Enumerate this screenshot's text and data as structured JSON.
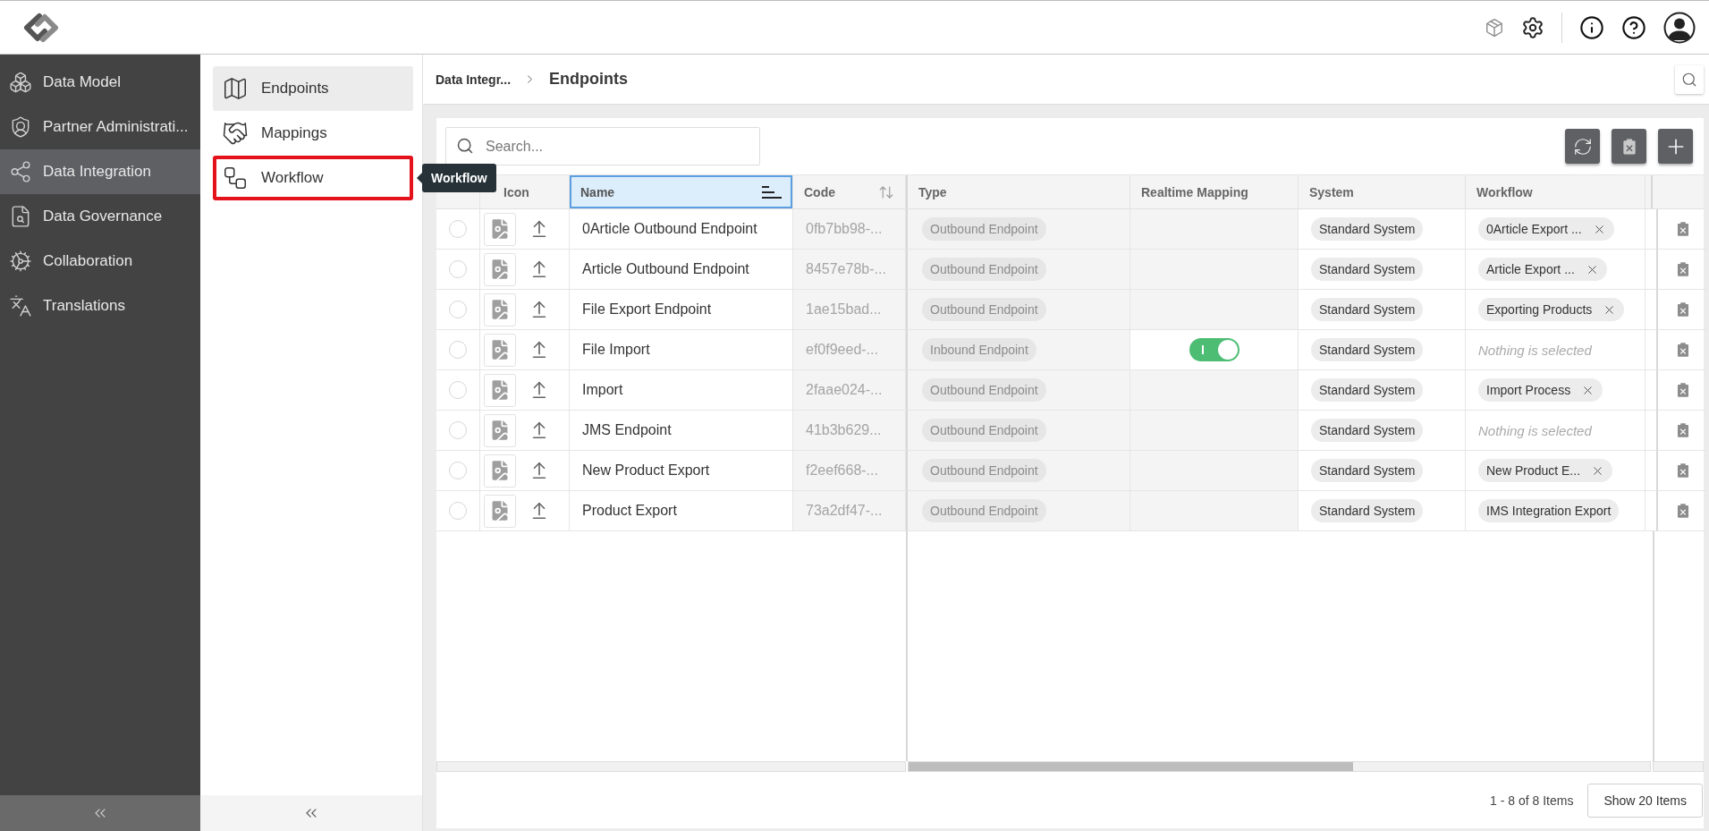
{
  "sidebar": {
    "items": [
      {
        "label": "Data Model",
        "selected": false
      },
      {
        "label": "Partner Administrati...",
        "selected": false
      },
      {
        "label": "Data Integration",
        "selected": true
      },
      {
        "label": "Data Governance",
        "selected": false
      },
      {
        "label": "Collaboration",
        "selected": false
      },
      {
        "label": "Translations",
        "selected": false
      }
    ]
  },
  "subnav": {
    "items": [
      {
        "label": "Endpoints",
        "selected": true,
        "highlighted": false
      },
      {
        "label": "Mappings",
        "selected": false,
        "highlighted": false
      },
      {
        "label": "Workflow",
        "selected": false,
        "highlighted": true,
        "tooltip": "Workflow"
      }
    ]
  },
  "breadcrumb": [
    {
      "label": "Data Integr...",
      "current": false
    },
    {
      "label": "Endpoints",
      "current": true
    }
  ],
  "table": {
    "search": {
      "placeholder": "Search..."
    },
    "columns": [
      {
        "label": "Icon"
      },
      {
        "label": "Name",
        "sorted": true
      },
      {
        "label": "Code",
        "sorted": false
      },
      {
        "label": "Type"
      },
      {
        "label": "Realtime Mapping"
      },
      {
        "label": "System"
      },
      {
        "label": "Workflow"
      }
    ],
    "rows": [
      {
        "selected": false,
        "name": "0Article Outbound Endpoint",
        "code": "0fb7bb98-...",
        "type": "Outbound Endpoint",
        "system": "Standard System",
        "workflow": {
          "value": "0Article Export ...",
          "clearable": true
        }
      },
      {
        "selected": false,
        "name": "Article Outbound Endpoint",
        "code": "8457e78b-...",
        "type": "Outbound Endpoint",
        "system": "Standard System",
        "workflow": {
          "value": "Article Export ...",
          "clearable": true
        }
      },
      {
        "selected": false,
        "name": "File Export Endpoint",
        "code": "1ae15bad...",
        "type": "Outbound Endpoint",
        "system": "Standard System",
        "workflow": {
          "value": "Exporting Products",
          "clearable": true
        }
      },
      {
        "selected": false,
        "name": "File Import",
        "code": "ef0f9eed-...",
        "type": "Inbound Endpoint",
        "realtime_mapping": {
          "on": true
        },
        "system": "Standard System",
        "workflow": {
          "placeholder": "Nothing is selected"
        }
      },
      {
        "selected": false,
        "name": "Import",
        "code": "2faae024-...",
        "type": "Outbound Endpoint",
        "system": "Standard System",
        "workflow": {
          "value": "Import Process",
          "clearable": true
        }
      },
      {
        "selected": false,
        "name": "JMS Endpoint",
        "code": "41b3b629...",
        "type": "Outbound Endpoint",
        "system": "Standard System",
        "workflow": {
          "placeholder": "Nothing is selected"
        }
      },
      {
        "selected": false,
        "name": "New Product Export",
        "code": "f2eef668-...",
        "type": "Outbound Endpoint",
        "system": "Standard System",
        "workflow": {
          "value": "New Product E...",
          "clearable": true
        }
      },
      {
        "selected": false,
        "name": "Product Export",
        "code": "73a2df47-...",
        "type": "Outbound Endpoint",
        "system": "Standard System",
        "workflow": {
          "value": "IMS Integration Export",
          "clearable": false
        }
      }
    ]
  },
  "pagination": {
    "summary": "1 - 8 of 8 Items",
    "page_size_button": "Show 20 Items"
  }
}
